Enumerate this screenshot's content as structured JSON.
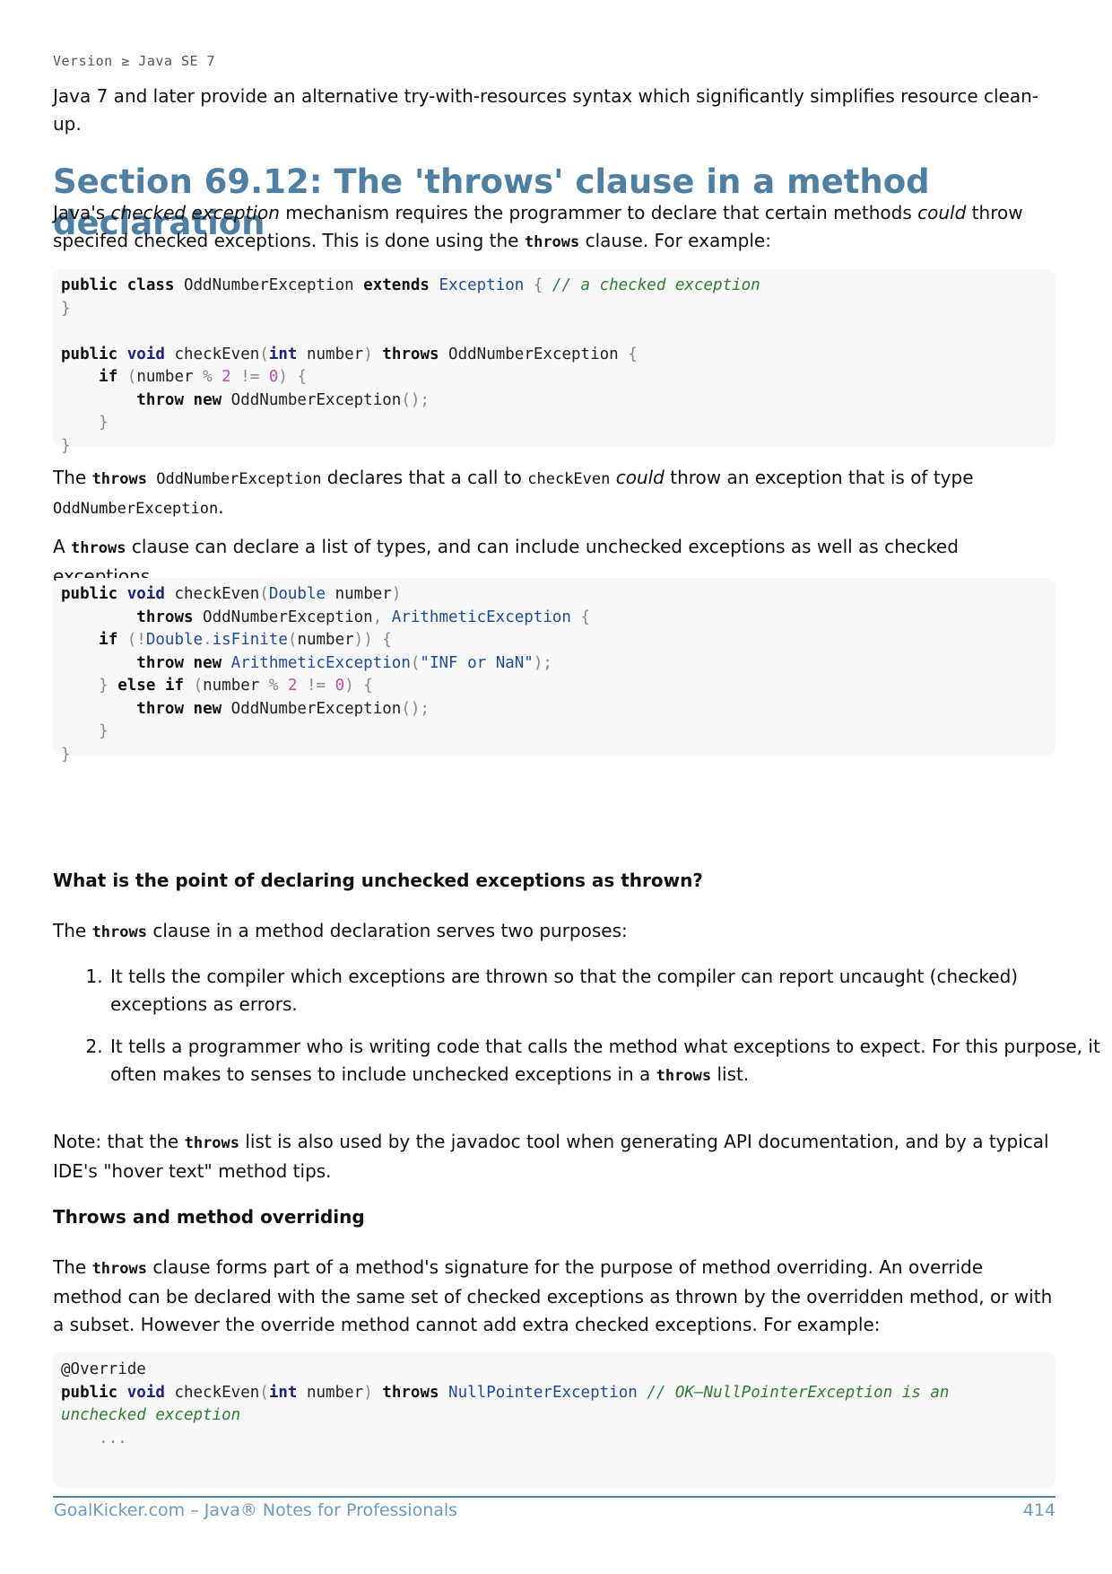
{
  "version_tag": "Version ≥ Java SE 7",
  "intro": "Java 7 and later provide an alternative try-with-resources syntax which significantly simplifies resource clean-up.",
  "section_title": "Section 69.12: The 'throws' clause in a method declaration",
  "p1": {
    "a": "Java's ",
    "b": "checked exception",
    "c": " mechanism requires the programmer to declare that certain methods ",
    "d": "could",
    "e": " throw specifed checked exceptions. This is done using the ",
    "code": "throws",
    "f": " clause. For example:"
  },
  "code1": {
    "l1": {
      "k1": "public",
      "k2": "class",
      "name": " OddNumberException ",
      "k3": "extends",
      "cls": "Exception",
      "brace": " { ",
      "comment": "// a checked exception"
    },
    "l2": "}",
    "l4": {
      "k1": "public",
      "t1": "void",
      "a": " checkEven",
      "p1": "(",
      "t2": "int",
      "b": " number",
      "p2": ")",
      "k2": "throws",
      "c": " OddNumberException ",
      "p3": "{"
    },
    "l5": {
      "k": "if",
      "p1": " (",
      "a": "number ",
      "op": "%",
      "n1": " 2",
      "op2": " != ",
      "n2": "0",
      "p2": ") {"
    },
    "l6": {
      "k1": "throw",
      "k2": "new",
      "a": " OddNumberException",
      "p": "();"
    },
    "l7": "}",
    "l8": "}"
  },
  "p2": {
    "a": "The ",
    "code1": "throws",
    "code2": " OddNumberException",
    "b": " declares that a call to ",
    "code3": "checkEven",
    "c": " ",
    "d": "could",
    "e": " throw an exception that is of type",
    "code4": "OddNumberException",
    "f": "."
  },
  "p3": {
    "a": "A ",
    "code": "throws",
    "b": " clause can declare a list of types, and can include unchecked exceptions as well as checked exceptions."
  },
  "code2": {
    "l1": {
      "k1": "public",
      "t1": "void",
      "a": " checkEven",
      "p1": "(",
      "cls": "Double",
      "b": " number",
      "p2": ")"
    },
    "l2": {
      "k": "throws",
      "a": " OddNumberException",
      "p": ",",
      "cls": " ArithmeticException",
      "p2": " {"
    },
    "l3": {
      "k": "if",
      "p1": " (!",
      "cls": "Double",
      "dot": ".",
      "meth": "isFinite",
      "p2": "(",
      "a": "number",
      "p3": ")) {"
    },
    "l4": {
      "k1": "throw",
      "k2": "new",
      "cls": " ArithmeticException",
      "p1": "(",
      "str": "\"INF or NaN\"",
      "p2": ");"
    },
    "l5": {
      "p1": "} ",
      "k1": "else",
      "k2": "if",
      "p2": " (",
      "a": "number ",
      "op": "%",
      "n1": " 2",
      "op2": " != ",
      "n2": "0",
      "p3": ") {"
    },
    "l6": {
      "k1": "throw",
      "k2": "new",
      "a": " OddNumberException",
      "p": "();"
    },
    "l7": "}",
    "l8": "}"
  },
  "h_point": "What is the point of declaring unchecked exceptions as thrown?",
  "p4": {
    "a": "The ",
    "code": "throws",
    "b": " clause in a method declaration serves two purposes:"
  },
  "list": {
    "item1": "It tells the compiler which exceptions are thrown so that the compiler can report uncaught (checked) exceptions as errors.",
    "item2a": "It tells a programmer who is writing code that calls the method what exceptions to expect. For this purpose, it often makes to senses to include unchecked exceptions in a ",
    "item2code": "throws",
    "item2b": " list."
  },
  "p5": {
    "a": "Note: that the ",
    "code": "throws",
    "b": " list is also used by the javadoc tool when generating API documentation, and by a typical IDE's \"hover text\" method tips."
  },
  "h_override": "Throws and method overriding",
  "p6": {
    "a": "The ",
    "code": "throws",
    "b": " clause forms part of a method's signature for the purpose of method overriding. An override method can be declared with the same set of checked exceptions as thrown by the overridden method, or with a subset. However the override method cannot add extra checked exceptions. For example:"
  },
  "code3": {
    "l1": "@Override",
    "l2": {
      "k1": "public",
      "t1": "void",
      "a": " checkEven",
      "p1": "(",
      "t2": "int",
      "b": " number",
      "p2": ")",
      "k2": "throws",
      "cls": " NullPointerException",
      "comment": " // OK—NullPointerException is an"
    },
    "l3": "unchecked exception",
    "l4": "..."
  },
  "footer": {
    "left": "GoalKicker.com – Java® Notes for Professionals",
    "right": "414"
  }
}
